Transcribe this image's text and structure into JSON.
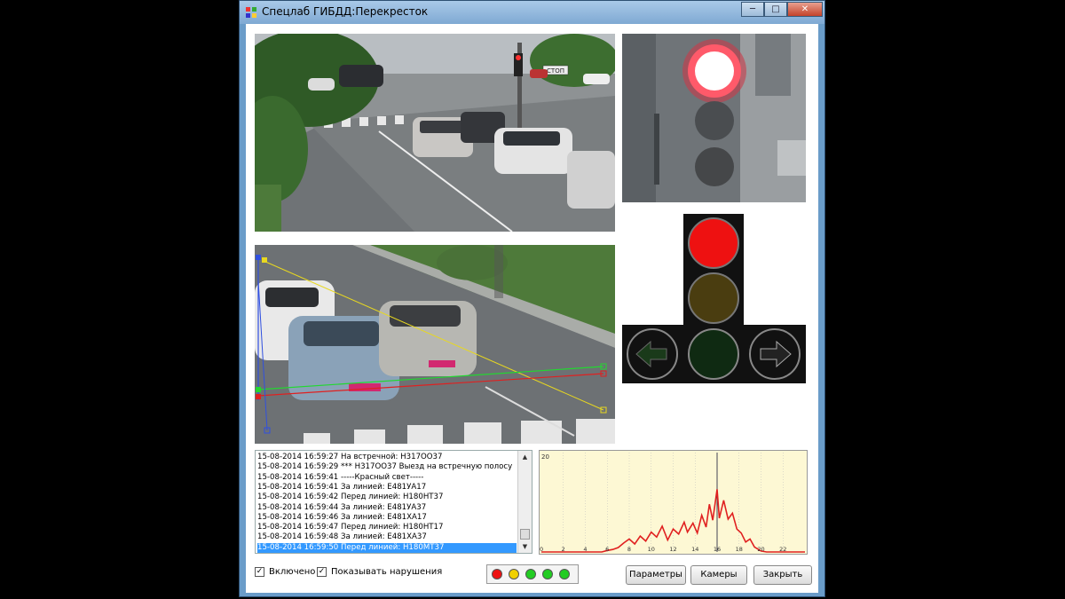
{
  "window": {
    "title": "Спецлаб ГИБДД:Перекресток",
    "minimize": "─",
    "maximize": "□",
    "close": "✕"
  },
  "video": {
    "top_left": {
      "sign": "СТОП"
    }
  },
  "log": {
    "rows": [
      "15-08-2014 16:59:27 На встречной: Н317ОО37",
      "15-08-2014 16:59:29 *** Н317ОО37 Выезд на встречную полосу",
      "15-08-2014 16:59:41 -----Красный свет-----",
      "15-08-2014 16:59:41 За линией: Е481УА17",
      "15-08-2014 16:59:42 Перед линией: Н180НТ37",
      "15-08-2014 16:59:44 За линией: Е481УА37",
      "15-08-2014 16:59:46 За линией: Е481ХА17",
      "15-08-2014 16:59:47 Перед линией: Н180НТ17",
      "15-08-2014 16:59:48 За линией: Е481ХА37",
      "15-08-2014 16:59:50 Перед линией: Н180МТ37"
    ],
    "selected_index": 9
  },
  "chart_data": {
    "type": "line",
    "ylim": [
      0,
      20
    ],
    "xlim": [
      0,
      24
    ],
    "y_tick_labels": [
      "20"
    ],
    "x_tick_labels": [
      "0",
      "2",
      "4",
      "6",
      "8",
      "10",
      "12",
      "14",
      "16",
      "18",
      "20",
      "22"
    ],
    "marker_x": 16,
    "series": [
      {
        "color": "#e02020",
        "values": [
          [
            0,
            0
          ],
          [
            5.5,
            0
          ],
          [
            6,
            0.3
          ],
          [
            6.5,
            0.5
          ],
          [
            7,
            0.9
          ],
          [
            7.5,
            1.8
          ],
          [
            8,
            2.6
          ],
          [
            8.5,
            1.6
          ],
          [
            9,
            3.2
          ],
          [
            9.5,
            2.2
          ],
          [
            10,
            4.0
          ],
          [
            10.5,
            3.0
          ],
          [
            11,
            5.2
          ],
          [
            11.5,
            2.4
          ],
          [
            12,
            4.6
          ],
          [
            12.5,
            3.6
          ],
          [
            13,
            6.0
          ],
          [
            13.3,
            4.0
          ],
          [
            13.8,
            5.8
          ],
          [
            14.2,
            3.8
          ],
          [
            14.6,
            7.4
          ],
          [
            15,
            5.0
          ],
          [
            15.3,
            9.6
          ],
          [
            15.6,
            6.4
          ],
          [
            16,
            12.6
          ],
          [
            16.2,
            6.8
          ],
          [
            16.6,
            10.4
          ],
          [
            17,
            6.6
          ],
          [
            17.4,
            7.8
          ],
          [
            17.8,
            4.6
          ],
          [
            18.2,
            3.8
          ],
          [
            18.6,
            2.0
          ],
          [
            19,
            2.6
          ],
          [
            19.4,
            1.0
          ],
          [
            20,
            0.2
          ],
          [
            20.5,
            0
          ],
          [
            24,
            0
          ]
        ]
      }
    ]
  },
  "controls": {
    "enabled_label": "Включено",
    "show_violations_label": "Показывать нарушения",
    "params_button": "Параметры",
    "cameras_button": "Камеры",
    "close_button": "Закрыть"
  },
  "colors": {
    "selection": "#3399ff",
    "histogram_bg": "#fdf8d4"
  }
}
